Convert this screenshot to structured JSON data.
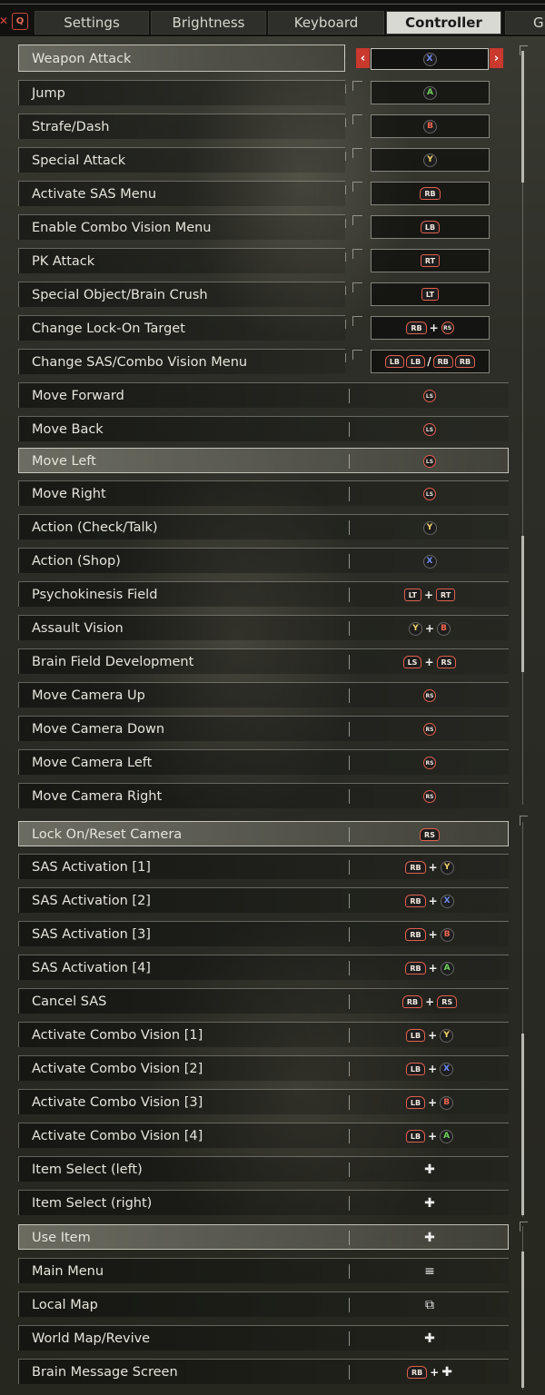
{
  "header": {
    "close_glyph": "✕",
    "q_glyph": "Q",
    "tabs": [
      {
        "label": "Settings"
      },
      {
        "label": "Brightness"
      },
      {
        "label": "Keyboard"
      },
      {
        "label": "Controller"
      },
      {
        "label": "Gr"
      }
    ]
  },
  "rows": [
    {
      "label": "Weapon Attack"
    },
    {
      "label": "Jump"
    },
    {
      "label": "Strafe/Dash"
    },
    {
      "label": "Special Attack"
    },
    {
      "label": "Activate SAS Menu"
    },
    {
      "label": "Enable Combo Vision Menu"
    },
    {
      "label": "PK Attack"
    },
    {
      "label": "Special Object/Brain Crush"
    },
    {
      "label": "Change Lock-On Target"
    },
    {
      "label": "Change SAS/Combo Vision Menu"
    },
    {
      "label": "Move Forward"
    },
    {
      "label": "Move Back"
    },
    {
      "label": "Move Left"
    },
    {
      "label": "Move Right"
    },
    {
      "label": "Action (Check/Talk)"
    },
    {
      "label": "Action (Shop)"
    },
    {
      "label": "Psychokinesis Field"
    },
    {
      "label": "Assault Vision"
    },
    {
      "label": "Brain Field Development"
    },
    {
      "label": "Move Camera Up"
    },
    {
      "label": "Move Camera Down"
    },
    {
      "label": "Move Camera Left"
    },
    {
      "label": "Move Camera Right"
    },
    {
      "label": "Lock On/Reset Camera"
    },
    {
      "label": "SAS Activation [1]"
    },
    {
      "label": "SAS Activation [2]"
    },
    {
      "label": "SAS Activation [3]"
    },
    {
      "label": "SAS Activation [4]"
    },
    {
      "label": "Cancel SAS"
    },
    {
      "label": "Activate Combo Vision [1]"
    },
    {
      "label": "Activate Combo Vision [2]"
    },
    {
      "label": "Activate Combo Vision [3]"
    },
    {
      "label": "Activate Combo Vision [4]"
    },
    {
      "label": "Item Select (left)"
    },
    {
      "label": "Item Select (right)"
    },
    {
      "label": "Use Item"
    },
    {
      "label": "Main Menu"
    },
    {
      "label": "Local Map"
    },
    {
      "label": "World Map/Revive"
    },
    {
      "label": "Brain Message Screen"
    }
  ],
  "glyphs": {
    "x": "X",
    "a": "A",
    "b": "B",
    "y": "Y",
    "rb": "RB",
    "lb": "LB",
    "rt": "RT",
    "lt": "LT",
    "ls": "LS",
    "rs": "RS",
    "plus": "+",
    "slash": "/",
    "arrow_left": "‹",
    "arrow_right": "›",
    "dpad": "✚",
    "menu": "≡",
    "map": "⧉"
  }
}
